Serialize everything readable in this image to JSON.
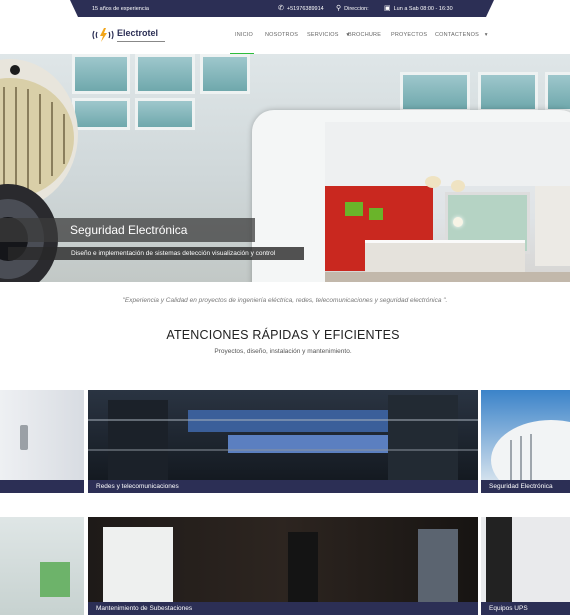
{
  "topbar": {
    "experience": "15 años de experiencia",
    "phone": "+51976389914",
    "address": "Direccion:",
    "hours": "Lun a Sab 08:00 - 16:30"
  },
  "brand": {
    "name": "Electrotel",
    "accent": "#2c2f55",
    "nav_active": "#2ebd3c"
  },
  "nav": {
    "items": [
      "INICIO",
      "NOSOTROS",
      "SERVICIOS",
      "BROCHURE",
      "PROYECTOS",
      "CONTACTENOS"
    ]
  },
  "hero": {
    "title": "Seguridad Electrónica",
    "subtitle": "Diseño e implementación de sistemas detección visualización y control"
  },
  "intro": {
    "quote": "\"Experiencia y Calidad en proyectos de ingeniería eléctrica, redes, telecomunicaciones y seguridad electrónica \".",
    "heading": "ATENCIONES RÁPIDAS Y EFICIENTES",
    "subheading": "Proyectos, diseño, instalación y mantenimiento."
  },
  "services": {
    "row1": [
      "Redes y telecomunicaciones",
      "Seguridad Electrónica"
    ],
    "row2": [
      "Mantenimiento de Subestaciones",
      "Equipos UPS"
    ]
  }
}
